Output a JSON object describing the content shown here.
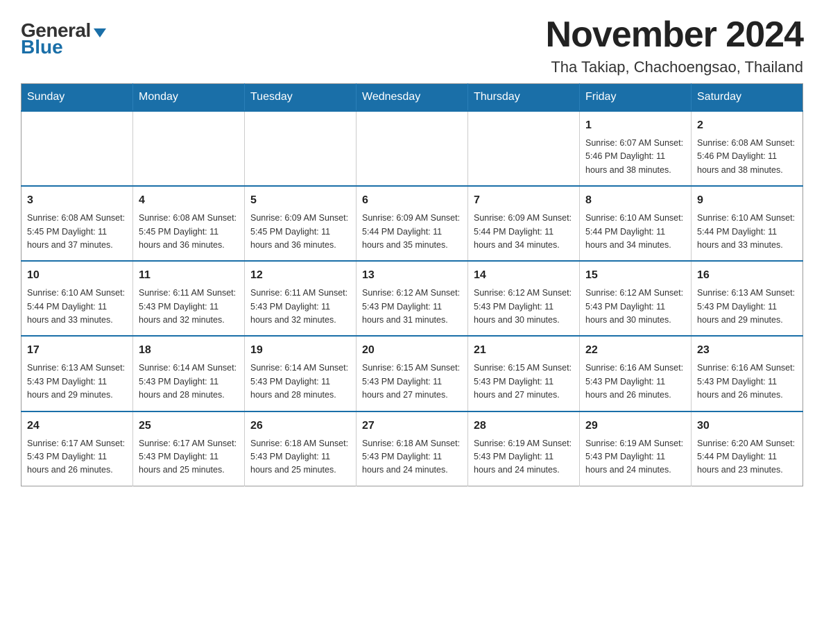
{
  "logo": {
    "general": "General",
    "blue": "Blue",
    "triangle": "▶"
  },
  "title": "November 2024",
  "location": "Tha Takiap, Chachoengsao, Thailand",
  "days_of_week": [
    "Sunday",
    "Monday",
    "Tuesday",
    "Wednesday",
    "Thursday",
    "Friday",
    "Saturday"
  ],
  "weeks": [
    [
      {
        "day": "",
        "info": ""
      },
      {
        "day": "",
        "info": ""
      },
      {
        "day": "",
        "info": ""
      },
      {
        "day": "",
        "info": ""
      },
      {
        "day": "",
        "info": ""
      },
      {
        "day": "1",
        "info": "Sunrise: 6:07 AM\nSunset: 5:46 PM\nDaylight: 11 hours and 38 minutes."
      },
      {
        "day": "2",
        "info": "Sunrise: 6:08 AM\nSunset: 5:46 PM\nDaylight: 11 hours and 38 minutes."
      }
    ],
    [
      {
        "day": "3",
        "info": "Sunrise: 6:08 AM\nSunset: 5:45 PM\nDaylight: 11 hours and 37 minutes."
      },
      {
        "day": "4",
        "info": "Sunrise: 6:08 AM\nSunset: 5:45 PM\nDaylight: 11 hours and 36 minutes."
      },
      {
        "day": "5",
        "info": "Sunrise: 6:09 AM\nSunset: 5:45 PM\nDaylight: 11 hours and 36 minutes."
      },
      {
        "day": "6",
        "info": "Sunrise: 6:09 AM\nSunset: 5:44 PM\nDaylight: 11 hours and 35 minutes."
      },
      {
        "day": "7",
        "info": "Sunrise: 6:09 AM\nSunset: 5:44 PM\nDaylight: 11 hours and 34 minutes."
      },
      {
        "day": "8",
        "info": "Sunrise: 6:10 AM\nSunset: 5:44 PM\nDaylight: 11 hours and 34 minutes."
      },
      {
        "day": "9",
        "info": "Sunrise: 6:10 AM\nSunset: 5:44 PM\nDaylight: 11 hours and 33 minutes."
      }
    ],
    [
      {
        "day": "10",
        "info": "Sunrise: 6:10 AM\nSunset: 5:44 PM\nDaylight: 11 hours and 33 minutes."
      },
      {
        "day": "11",
        "info": "Sunrise: 6:11 AM\nSunset: 5:43 PM\nDaylight: 11 hours and 32 minutes."
      },
      {
        "day": "12",
        "info": "Sunrise: 6:11 AM\nSunset: 5:43 PM\nDaylight: 11 hours and 32 minutes."
      },
      {
        "day": "13",
        "info": "Sunrise: 6:12 AM\nSunset: 5:43 PM\nDaylight: 11 hours and 31 minutes."
      },
      {
        "day": "14",
        "info": "Sunrise: 6:12 AM\nSunset: 5:43 PM\nDaylight: 11 hours and 30 minutes."
      },
      {
        "day": "15",
        "info": "Sunrise: 6:12 AM\nSunset: 5:43 PM\nDaylight: 11 hours and 30 minutes."
      },
      {
        "day": "16",
        "info": "Sunrise: 6:13 AM\nSunset: 5:43 PM\nDaylight: 11 hours and 29 minutes."
      }
    ],
    [
      {
        "day": "17",
        "info": "Sunrise: 6:13 AM\nSunset: 5:43 PM\nDaylight: 11 hours and 29 minutes."
      },
      {
        "day": "18",
        "info": "Sunrise: 6:14 AM\nSunset: 5:43 PM\nDaylight: 11 hours and 28 minutes."
      },
      {
        "day": "19",
        "info": "Sunrise: 6:14 AM\nSunset: 5:43 PM\nDaylight: 11 hours and 28 minutes."
      },
      {
        "day": "20",
        "info": "Sunrise: 6:15 AM\nSunset: 5:43 PM\nDaylight: 11 hours and 27 minutes."
      },
      {
        "day": "21",
        "info": "Sunrise: 6:15 AM\nSunset: 5:43 PM\nDaylight: 11 hours and 27 minutes."
      },
      {
        "day": "22",
        "info": "Sunrise: 6:16 AM\nSunset: 5:43 PM\nDaylight: 11 hours and 26 minutes."
      },
      {
        "day": "23",
        "info": "Sunrise: 6:16 AM\nSunset: 5:43 PM\nDaylight: 11 hours and 26 minutes."
      }
    ],
    [
      {
        "day": "24",
        "info": "Sunrise: 6:17 AM\nSunset: 5:43 PM\nDaylight: 11 hours and 26 minutes."
      },
      {
        "day": "25",
        "info": "Sunrise: 6:17 AM\nSunset: 5:43 PM\nDaylight: 11 hours and 25 minutes."
      },
      {
        "day": "26",
        "info": "Sunrise: 6:18 AM\nSunset: 5:43 PM\nDaylight: 11 hours and 25 minutes."
      },
      {
        "day": "27",
        "info": "Sunrise: 6:18 AM\nSunset: 5:43 PM\nDaylight: 11 hours and 24 minutes."
      },
      {
        "day": "28",
        "info": "Sunrise: 6:19 AM\nSunset: 5:43 PM\nDaylight: 11 hours and 24 minutes."
      },
      {
        "day": "29",
        "info": "Sunrise: 6:19 AM\nSunset: 5:43 PM\nDaylight: 11 hours and 24 minutes."
      },
      {
        "day": "30",
        "info": "Sunrise: 6:20 AM\nSunset: 5:44 PM\nDaylight: 11 hours and 23 minutes."
      }
    ]
  ]
}
